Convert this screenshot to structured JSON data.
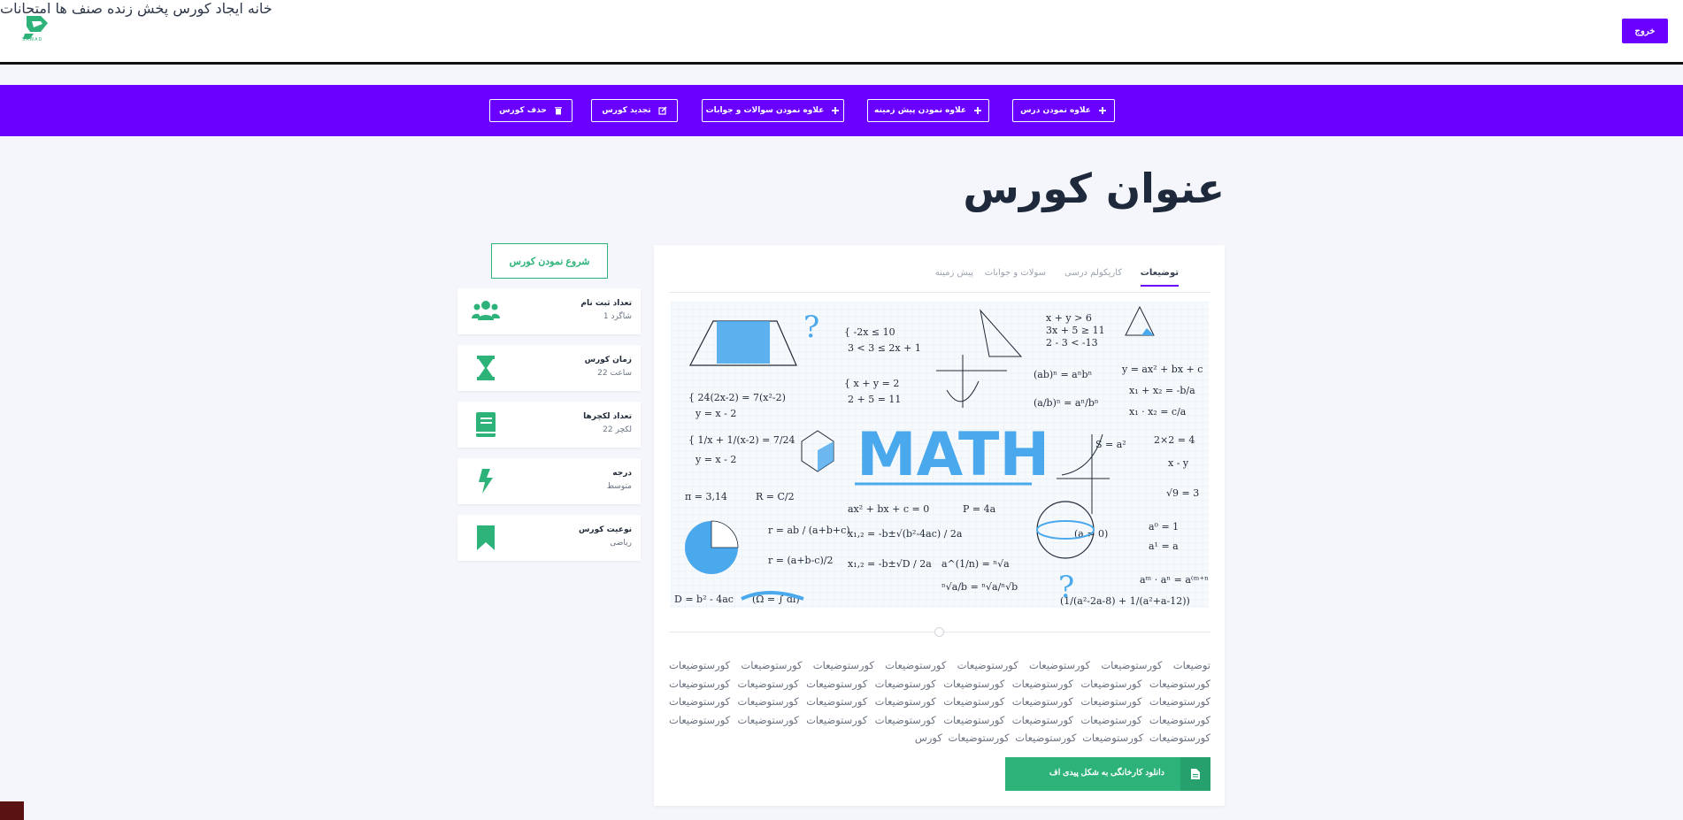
{
  "header": {
    "logo_text": "SAWAD",
    "nav": [
      {
        "label": "خانه"
      },
      {
        "label": "ایجاد کورس"
      },
      {
        "label": "پخش زنده"
      },
      {
        "label": "صنف ها"
      },
      {
        "label": "امتحانات"
      }
    ],
    "logout_label": "خروج"
  },
  "toolbar": {
    "add_lesson": "علاوه نمودن درس",
    "add_prereq": "علاوه نمودن پیش زمینه",
    "add_qa": "علاوه نمودن سوالات و جوابات",
    "edit_course": "تجدید کورس",
    "delete_course": "حذف کورس"
  },
  "course": {
    "title": "عنوان کورس",
    "start_label": "شروع نمودن کورس"
  },
  "info": [
    {
      "label": "تعداد ثبت نام",
      "value": "1 شاگرد",
      "icon": "users-icon"
    },
    {
      "label": "زمان کورس",
      "value": "22 ساعت",
      "icon": "hourglass-icon"
    },
    {
      "label": "تعداد لکچرها",
      "value": "22 لکچر",
      "icon": "book-icon"
    },
    {
      "label": "درجه",
      "value": "متوسط",
      "icon": "lightning-icon"
    },
    {
      "label": "نوعیت کورس",
      "value": "ریاضی",
      "icon": "bookmark-icon"
    }
  ],
  "tabs": [
    {
      "label": "توضیعات"
    },
    {
      "label": "کاریکولم درسی"
    },
    {
      "label": "سولات و جوابات"
    },
    {
      "label": "پیش زمینه"
    }
  ],
  "image": {
    "math_word": "MATH"
  },
  "description": "توضیعات کورستوضیعات کورستوضیعات کورستوضیعات کورستوضیعات کورستوضیعات کورستوضیعات کورستوضیعات کورستوضیعات کورستوضیعات کورستوضیعات کورستوضیعات کورستوضیعات کورستوضیعات کورستوضیعات کورستوضیعات کورستوضیعات کورستوضیعات کورستوضیعات کورستوضیعات کورستوضیعات کورستوضیعات کورستوضیعات کورستوضیعات کورستوضیعات کورستوضیعات کورستوضیعات کورستوضیعات کورستوضیعات کورستوضیعات کورستوضیعات کورستوضیعات کورستوضیعات کورستوضیعات کورستوضیعات کورستوضیعات کورس",
  "pdf_button": "دانلود کارخانگی به شکل پیدی اف",
  "colors": {
    "brand": "#6a00ff",
    "accent": "#2db37a"
  }
}
